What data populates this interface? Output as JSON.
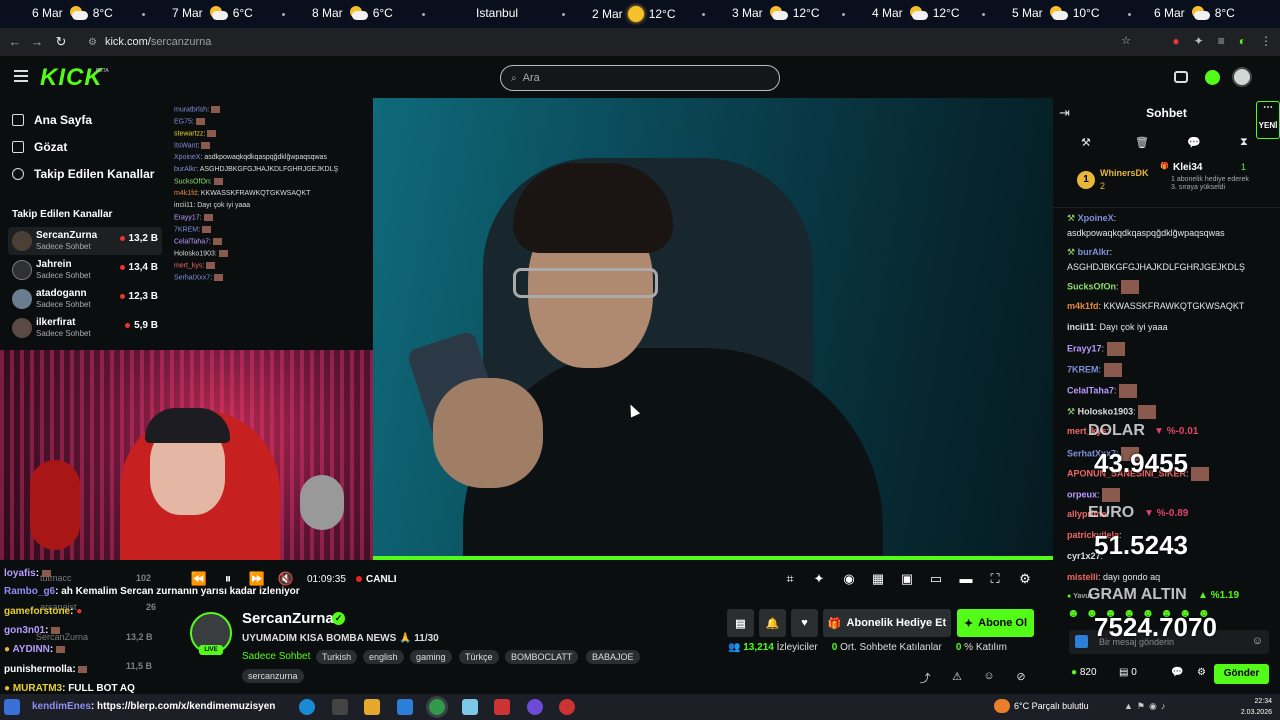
{
  "ticker": [
    {
      "label": "6 Mar",
      "temp": "8°C",
      "icon": "partly-cloudy-icon"
    },
    {
      "label": "7 Mar",
      "temp": "6°C",
      "icon": "partly-cloudy-icon"
    },
    {
      "label": "8 Mar",
      "temp": "6°C",
      "icon": "partly-cloudy-icon"
    },
    {
      "label": "Istanbul",
      "temp": "",
      "icon": ""
    },
    {
      "label": "2 Mar",
      "temp": "12°C",
      "icon": "sun-icon"
    },
    {
      "label": "3 Mar",
      "temp": "12°C",
      "icon": "partly-cloudy-icon"
    },
    {
      "label": "4 Mar",
      "temp": "12°C",
      "icon": "partly-cloudy-icon"
    },
    {
      "label": "5 Mar",
      "temp": "10°C",
      "icon": "partly-cloudy-icon"
    },
    {
      "label": "6 Mar",
      "temp": "8°C",
      "icon": "partly-cloudy-icon"
    }
  ],
  "browser": {
    "url_host": "kick.com/",
    "url_path": "sercanzurna"
  },
  "header": {
    "logo": "KICK",
    "beta": "BETA",
    "search_placeholder": "Ara"
  },
  "sidebar": {
    "nav": [
      {
        "label": "Ana Sayfa",
        "icon": "home-icon"
      },
      {
        "label": "Gözat",
        "icon": "browse-icon"
      },
      {
        "label": "Takip Edilen Kanallar",
        "icon": "heart-icon"
      }
    ],
    "followed_title": "Takip Edilen Kanallar",
    "channels": [
      {
        "name": "SercanZurna",
        "category": "Sadece Sohbet",
        "viewers": "13,2 B"
      },
      {
        "name": "Jahrein",
        "category": "Sadece Sohbet",
        "viewers": "13,4 B"
      },
      {
        "name": "atadogann",
        "category": "Sadece Sohbet",
        "viewers": "12,3 B"
      },
      {
        "name": "ilkerfirat",
        "category": "Sadece Sohbet",
        "viewers": "5,9 B"
      }
    ]
  },
  "overlay_chat": [
    {
      "user": "muratbrlsh",
      "text": ""
    },
    {
      "user": "EG75",
      "text": ""
    },
    {
      "user": "stewartzz",
      "text": ""
    },
    {
      "user": "ItsWant",
      "text": ""
    },
    {
      "user": "XpoineX",
      "text": "asdkpowaqkqdkqaspqğdklğwpaqsqwas"
    },
    {
      "user": "burAlkr",
      "text": "ASGHDJBKGFGJHAJKDLFGHRJGEJKDLŞ"
    },
    {
      "user": "SucksOfOn",
      "text": ""
    },
    {
      "user": "m4k1fd",
      "text": "KKWASSKFRAWKQTGKWSAQKT"
    },
    {
      "user": "incii11",
      "text": "Dayı çok iyi yaaa"
    },
    {
      "user": "Erayy17",
      "text": ""
    },
    {
      "user": "7KREM",
      "text": ""
    },
    {
      "user": "CelalTaha7",
      "text": ""
    },
    {
      "user": "Holosko1903",
      "text": ""
    },
    {
      "user": "mert_kys",
      "text": ""
    },
    {
      "user": "SerhatXxx7",
      "text": ""
    }
  ],
  "player": {
    "time": "01:09:35",
    "live": "CANLI"
  },
  "channel": {
    "name": "SercanZurna",
    "title": "UYUMADIM KISA BOMBA NEWS 🙏 11/30",
    "category": "Sadece Sohbet",
    "live_badge": "LIVE",
    "tags": [
      "Turkish",
      "english",
      "gaming",
      "Türkçe",
      "BOMBOCLATT",
      "BABAJOE",
      "sercanzurna"
    ],
    "gift_button": "Abonelik Hediye Et",
    "subscribe_button": "Abone Ol",
    "viewers": "13,214",
    "viewers_label": "İzleyiciler",
    "chat_participants": "0",
    "chat_participants_label": "Ort. Sohbete Katılanlar",
    "participation": "0",
    "participation_label": "% Katılım"
  },
  "overlay_bottom": [
    {
      "user": "loyafis",
      "text": ":"
    },
    {
      "user": "Rambo_g6",
      "text": ": ah Kemalim Sercan zurnanın yarısı kadar izleniyor"
    },
    {
      "user": "gameforstone",
      "text": ":"
    },
    {
      "user": "gon3n01",
      "text": ":"
    },
    {
      "user": "AYDINN",
      "text": ":"
    },
    {
      "user": "punishermolla",
      "text": ":"
    },
    {
      "user": "MURATM3",
      "text": ": FULL BOT AQ"
    },
    {
      "user": "kendimEnes",
      "text": ": https://blerp.com/x/kendimemuzisyen"
    }
  ],
  "overlay_sidebar_faint": [
    {
      "name": "tutmacc",
      "viewers": "102"
    },
    {
      "name": "arcanaist",
      "viewers": "26"
    },
    {
      "name": "SercanZurna",
      "viewers": "13,2 B"
    },
    {
      "name": "",
      "viewers": "11,5 B"
    }
  ],
  "chat": {
    "title": "Sohbet",
    "new_label": "YENİ",
    "pinned": {
      "rank": "1",
      "user": "WhinersDK",
      "count": "2",
      "gifter": "Klei34",
      "gifter_count": "1",
      "gifter_text": "1 abonelik hediye ederek 3. sıraya yükseldi"
    },
    "messages": [
      {
        "user": "XpoineX",
        "text": "asdkpowaqkqdkqaspqğdklğwpaqsqwas",
        "color": "#7f8fd9"
      },
      {
        "user": "burAlkr",
        "text": "ASGHDJBKGFGJHAJKDLFGHRJGEJKDLŞ",
        "color": "#7f8fd9"
      },
      {
        "user": "SucksOfOn",
        "text": "",
        "color": "#8fde6a"
      },
      {
        "user": "m4k1fd",
        "text": "KKWASSKFRAWKQTGKWSAQKT",
        "color": "#e8873a"
      },
      {
        "user": "incii11",
        "text": "Dayı çok iyi yaaa",
        "color": "#ddd"
      },
      {
        "user": "Erayy17",
        "text": "",
        "color": "#b99bff"
      },
      {
        "user": "7KREM",
        "text": "",
        "color": "#7f8fd9"
      },
      {
        "user": "CelalTaha7",
        "text": "",
        "color": "#b99bff"
      },
      {
        "user": "Holosko1903",
        "text": "",
        "color": "#ddd"
      },
      {
        "user": "mert_kys",
        "text": "",
        "color": "#e66"
      },
      {
        "user": "SerhatXxx7",
        "text": "",
        "color": "#7f8fd9"
      },
      {
        "user": "APONUN_SANESINI_SIKER",
        "text": "",
        "color": "#e66"
      },
      {
        "user": "orpeux",
        "text": "",
        "color": "#b99bff"
      },
      {
        "user": "allyprime",
        "text": "",
        "color": "#e66"
      },
      {
        "user": "patrickvilela",
        "text": "",
        "color": "#e66"
      },
      {
        "user": "cyr1x27",
        "text": "",
        "color": "#ddd"
      },
      {
        "user": "mistelli",
        "text": "dayı gondo aq",
        "color": "#e66"
      },
      {
        "user": "Yavuz",
        "text": "",
        "color": "#aaa"
      }
    ],
    "input_placeholder": "Bir mesaj gönderin",
    "points": "820",
    "count": "0",
    "send": "Gönder"
  },
  "finance": [
    {
      "label": "DOLAR",
      "value": "43.9455",
      "change": "%-0.01",
      "dir": "down",
      "color": "#e0436b"
    },
    {
      "label": "EURO",
      "value": "51.5243",
      "change": "%-0.89",
      "dir": "down",
      "color": "#e0436b"
    },
    {
      "label": "GRAM ALTIN",
      "value": "7524.7070",
      "change": "%1.19",
      "dir": "up",
      "color": "#53fc18"
    }
  ],
  "taskbar": {
    "weather": "6°C",
    "weather_text": "Parçalı bulutlu",
    "time": "22:34",
    "date": "2.03.2026"
  }
}
